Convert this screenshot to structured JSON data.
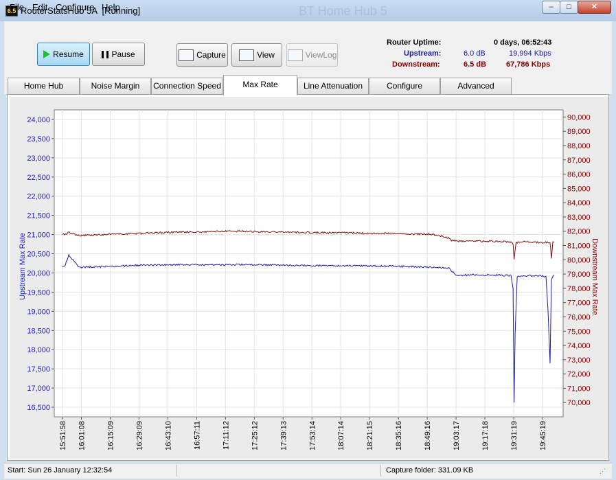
{
  "window": {
    "title": "RouterStatsHub 5A  [Running]",
    "badge": "6.5",
    "ghost_title": "BT Home Hub 5",
    "min_glyph": "–",
    "max_glyph": "□",
    "close_glyph": "✕"
  },
  "menu": [
    "File",
    "Edit",
    "Configure",
    "Help"
  ],
  "toolbar": {
    "resume": "Resume",
    "pause": "Pause",
    "capture": "Capture",
    "view": "View",
    "viewlog": "ViewLog"
  },
  "stats": {
    "uptime_label": "Router Uptime:",
    "uptime_value": "0 days, 06:52:43",
    "upstream_label": "Upstream:",
    "upstream_db": "6.0 dB",
    "upstream_rate": "19,994 Kbps",
    "downstream_label": "Downstream:",
    "downstream_db": "6.5 dB",
    "downstream_rate": "67,786 Kbps",
    "upstream_color": "#1a1a9c",
    "downstream_color": "#8b0000"
  },
  "tabs": [
    "Home Hub",
    "Noise Margin",
    "Connection Speed",
    "Max Rate",
    "Line Attenuation",
    "Configure",
    "Advanced"
  ],
  "active_tab": "Max Rate",
  "status": {
    "start": "Start: Sun 26 January 12:32:54",
    "folder": "Capture folder:  331.09 KB"
  },
  "chart_data": {
    "type": "line",
    "ylabel": "Upstream Max Rate",
    "y2label": "Downstream Max Rate",
    "ylim": [
      16250,
      24250
    ],
    "y2lim": [
      69000,
      90500
    ],
    "yticks": [
      "24,000",
      "23,500",
      "23,000",
      "22,500",
      "22,000",
      "21,500",
      "21,000",
      "20,500",
      "20,000",
      "19,500",
      "19,000",
      "18,500",
      "18,000",
      "17,500",
      "17,000",
      "16,500"
    ],
    "y2ticks": [
      "90,000",
      "89,000",
      "88,000",
      "87,000",
      "86,000",
      "85,000",
      "84,000",
      "83,000",
      "82,000",
      "81,000",
      "80,000",
      "79,000",
      "78,000",
      "77,000",
      "76,000",
      "75,000",
      "74,000",
      "73,000",
      "72,000",
      "71,000",
      "70,000"
    ],
    "xticks": [
      "15:51:58",
      "16:01:08",
      "16:15:09",
      "16:29:09",
      "16:43:10",
      "16:57:11",
      "17:11:12",
      "17:25:12",
      "17:39:13",
      "17:53:14",
      "18:07:14",
      "18:21:15",
      "18:35:16",
      "18:49:16",
      "19:03:17",
      "19:17:18",
      "19:31:19",
      "19:45:19"
    ],
    "grid": true,
    "series": [
      {
        "name": "Upstream",
        "axis": "left",
        "color": "#1a1aa8",
        "x": [
          "15:51:58",
          "15:53:00",
          "15:55:00",
          "16:00:00",
          "16:10:00",
          "16:20:00",
          "16:30:00",
          "16:40:00",
          "16:50:00",
          "17:00:00",
          "17:10:00",
          "17:20:00",
          "17:30:00",
          "17:40:00",
          "17:50:00",
          "18:00:00",
          "18:10:00",
          "18:20:00",
          "18:30:00",
          "18:40:00",
          "18:50:00",
          "19:00:00",
          "19:01:00",
          "19:04:00",
          "19:05:00",
          "19:10:00",
          "19:20:00",
          "19:30:00",
          "19:31:00",
          "19:31:30",
          "19:32:00",
          "19:33:00",
          "19:34:00",
          "19:40:00",
          "19:45:00",
          "19:47:00",
          "19:48:00",
          "19:49:00",
          "19:49:40",
          "19:50:20",
          "19:51:00"
        ],
        "values": [
          20160,
          20170,
          20470,
          20150,
          20160,
          20180,
          20200,
          20210,
          20220,
          20210,
          20210,
          20220,
          20210,
          20200,
          20190,
          20190,
          20190,
          20180,
          20180,
          20170,
          20150,
          20130,
          20050,
          19920,
          19940,
          19950,
          19950,
          19930,
          19600,
          16620,
          18400,
          19900,
          19920,
          19930,
          19920,
          19900,
          19000,
          17650,
          19800,
          19930,
          19950
        ]
      },
      {
        "name": "Downstream",
        "axis": "right",
        "color": "#7a1010",
        "x": [
          "15:51:58",
          "15:53:00",
          "15:55:00",
          "16:00:00",
          "16:10:00",
          "16:20:00",
          "16:30:00",
          "16:40:00",
          "16:50:00",
          "17:00:00",
          "17:10:00",
          "17:20:00",
          "17:30:00",
          "17:40:00",
          "17:50:00",
          "18:00:00",
          "18:10:00",
          "18:20:00",
          "18:30:00",
          "18:40:00",
          "18:50:00",
          "18:55:00",
          "19:00:00",
          "19:01:00",
          "19:05:00",
          "19:10:00",
          "19:20:00",
          "19:30:00",
          "19:31:00",
          "19:31:30",
          "19:32:30",
          "19:34:00",
          "19:40:00",
          "19:45:00",
          "19:49:00",
          "19:49:40",
          "19:50:20",
          "19:51:00"
        ],
        "values": [
          81800,
          81750,
          81900,
          81700,
          81750,
          81800,
          81850,
          81900,
          81950,
          81950,
          82000,
          82000,
          81950,
          81950,
          81900,
          81900,
          81900,
          81850,
          81850,
          81800,
          81800,
          81700,
          81500,
          81350,
          81300,
          81300,
          81300,
          81250,
          81100,
          80000,
          81200,
          81250,
          81250,
          81200,
          81250,
          80100,
          81200,
          81250
        ]
      }
    ]
  }
}
